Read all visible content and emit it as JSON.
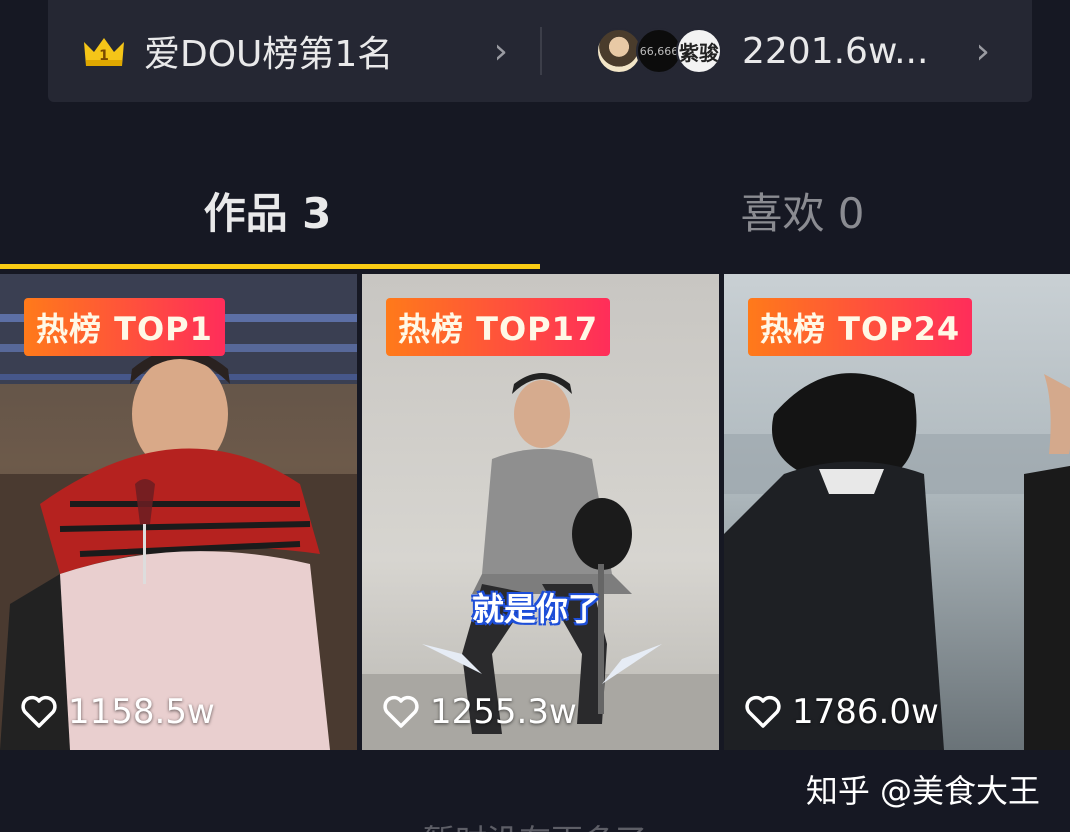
{
  "info_bar": {
    "rank_label": "爱DOU榜第1名",
    "rank_badge": "1",
    "fans_count": "2201.6w...",
    "avatar_2_text": "66,666",
    "avatar_3_text": "紫骏"
  },
  "tabs": [
    {
      "label": "作品 3",
      "active": true
    },
    {
      "label": "喜欢 0",
      "active": false
    }
  ],
  "videos": [
    {
      "badge": "热榜 TOP1",
      "likes": "1158.5w"
    },
    {
      "badge": "热榜 TOP17",
      "likes": "1255.3w",
      "caption": "就是你了"
    },
    {
      "badge": "热榜 TOP24",
      "likes": "1786.0w"
    }
  ],
  "footer_text": "暂时没有更多了",
  "watermark": "知乎 @美食大王",
  "colors": {
    "background": "#161823",
    "accent_underline": "#facc15",
    "badge_start": "#ff7a1a",
    "badge_end": "#ff2d5a"
  }
}
